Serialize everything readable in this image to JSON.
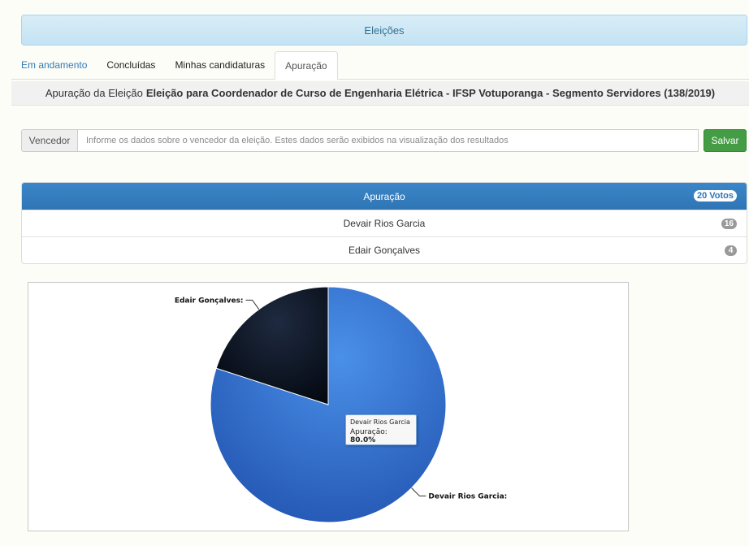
{
  "header": {
    "title": "Eleições"
  },
  "tabs": [
    {
      "label": "Em andamento"
    },
    {
      "label": "Concluídas"
    },
    {
      "label": "Minhas candidaturas"
    },
    {
      "label": "Apuração"
    }
  ],
  "title_bar": {
    "prefix": "Apuração da Eleição",
    "election": "Eleição para Coordenador de Curso de Engenharia Elétrica - IFSP Votuporanga - Segmento Servidores (138/2019)"
  },
  "winner": {
    "label": "Vencedor",
    "placeholder": "Informe os dados sobre o vencedor da eleição. Estes dados serão exibidos na visualização dos resultados",
    "save_label": "Salvar"
  },
  "results": {
    "header": "Apuração",
    "total_badge": "20 Votos",
    "rows": [
      {
        "name": "Devair Rios Garcia",
        "votes": "16"
      },
      {
        "name": "Edair Gonçalves",
        "votes": "4"
      }
    ]
  },
  "chart_data": {
    "type": "pie",
    "slices": [
      {
        "name": "Devair Rios Garcia",
        "value": 16,
        "label": "Devair Rios Garcia:",
        "color": "#2c63c8"
      },
      {
        "name": "Edair Gonçalves",
        "value": 4,
        "label": "Edair Gonçalves:",
        "color": "#0c1626"
      }
    ],
    "tooltip": {
      "name": "Devair Rios Garcia",
      "metric": "Apuração",
      "value": "80.0%"
    }
  }
}
